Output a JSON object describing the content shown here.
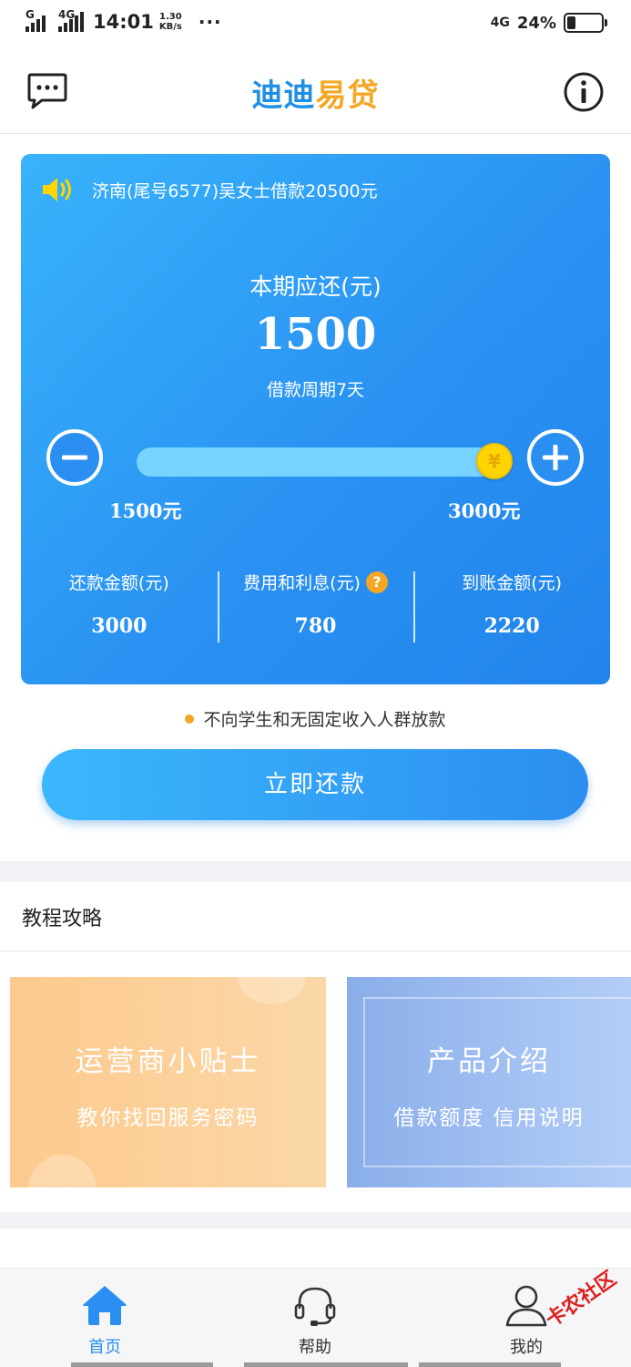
{
  "status_bar": {
    "signal_label": "G",
    "network_left": "4G",
    "time": "14:01",
    "speed_value": "1.30",
    "speed_unit": "KB/s",
    "dots": "···",
    "network_right": "4G",
    "battery_percent": "24%",
    "battery_level": 0.24
  },
  "header": {
    "title_part1": "迪迪",
    "title_part2": "易贷"
  },
  "card": {
    "notice": "济南(尾号6577)吴女士借款20500元",
    "due_label": "本期应还(元)",
    "due_amount": "1500",
    "period": "借款周期7天",
    "slider": {
      "min_label": "1500元",
      "max_label": "3000元",
      "level": 1.0
    },
    "stats": [
      {
        "label": "还款金额(元)",
        "value": "3000"
      },
      {
        "label": "费用和利息(元)",
        "value": "780",
        "help": "?"
      },
      {
        "label": "到账金额(元)",
        "value": "2220"
      }
    ],
    "knob_symbol": "¥"
  },
  "disclaimer": "不向学生和无固定收入人群放款",
  "repay_button": "立即还款",
  "section_title": "教程攻略",
  "tiles": [
    {
      "title": "运营商小贴士",
      "subtitle": "教你找回服务密码"
    },
    {
      "title": "产品介绍",
      "subtitle": "借款额度  信用说明"
    }
  ],
  "tabs": [
    {
      "label": "首页",
      "active": true
    },
    {
      "label": "帮助",
      "active": false
    },
    {
      "label": "我的",
      "active": false
    }
  ],
  "watermark": "卡农社区",
  "colors": {
    "primary": "#2a8ff0",
    "accent": "#f5a623"
  }
}
